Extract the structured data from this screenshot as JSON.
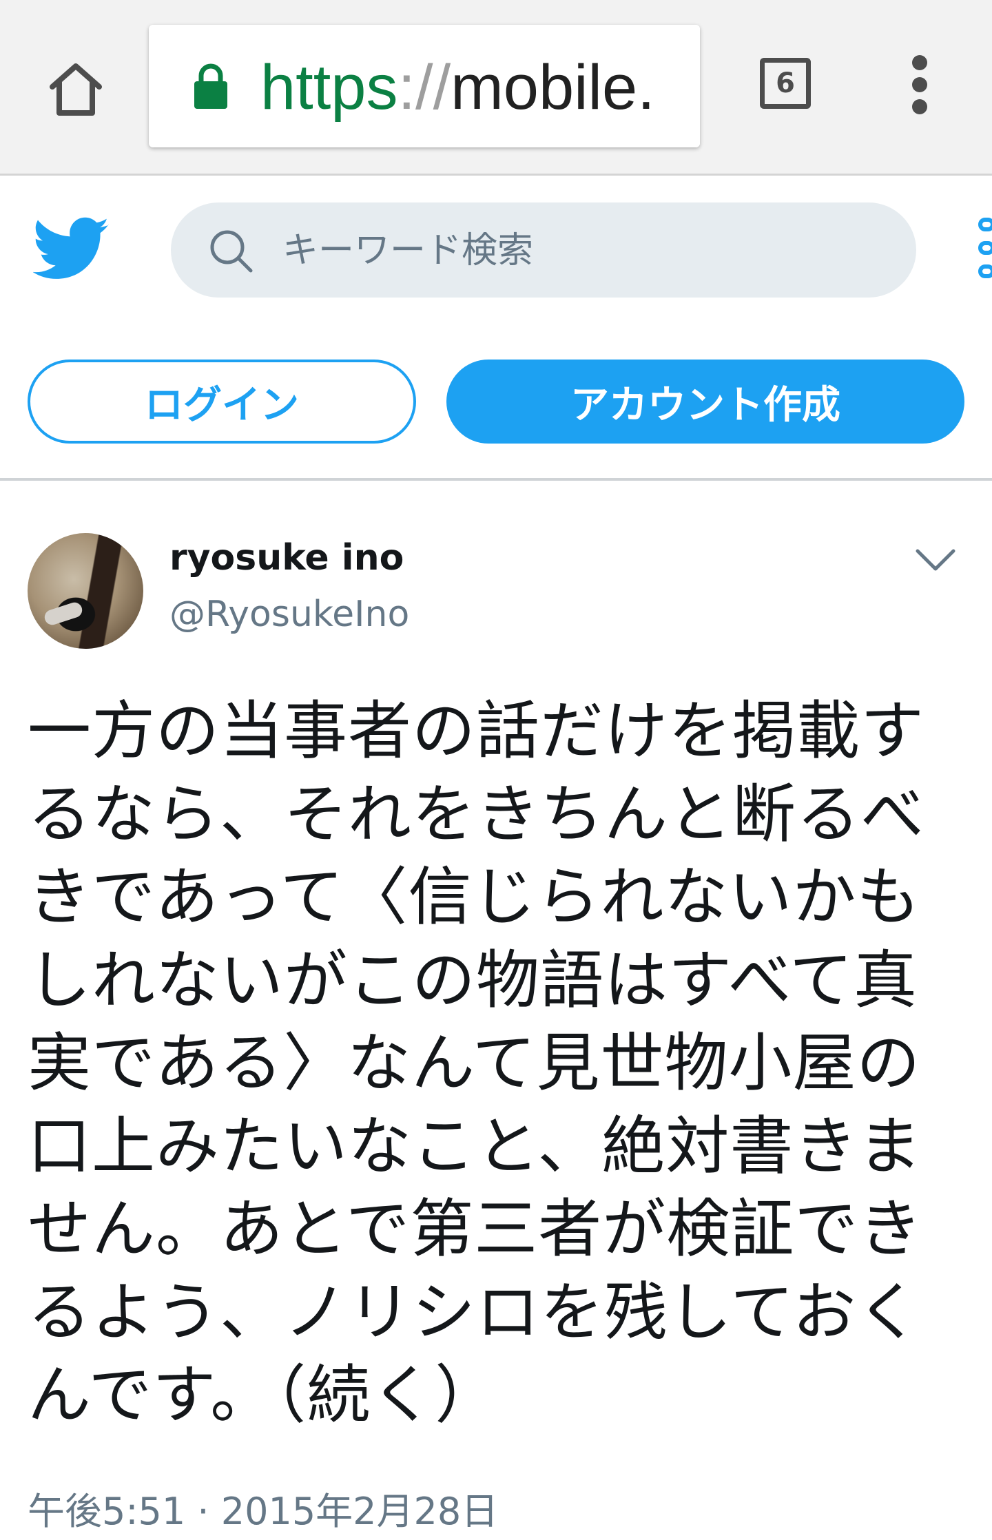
{
  "browser": {
    "home_icon": "home-icon",
    "lock_icon": "lock-icon",
    "url_scheme": "https",
    "url_separator": "://",
    "url_host": "mobile.",
    "tab_count": "6",
    "menu_icon": "more-vert-icon",
    "colors": {
      "scheme": "#0b8043",
      "separator": "#9e9e9e",
      "host": "#212121",
      "lock": "#0b8043"
    }
  },
  "twitter": {
    "logo": "twitter-bird-icon",
    "search": {
      "placeholder": "キーワード検索",
      "value": ""
    },
    "login_label": "ログイン",
    "signup_label": "アカウント作成",
    "accent_color": "#1da1f2"
  },
  "tweet": {
    "display_name": "ryosuke ino",
    "handle": "@RyosukeIno",
    "lines": [
      "一方の当事者の話だけを掲載す",
      "るなら、それをきちんと断るべ",
      "きであって〈信じられないかも",
      "しれないがこの物語はすべて真",
      "実である〉なんて見世物小屋の",
      "口上みたいなこと、絶対書きま",
      "せん。あとで第三者が検証でき",
      "るよう、ノリシロを残しておく",
      "んです。（続く）"
    ],
    "timestamp": "午後5:51 · 2015年2月28日"
  }
}
